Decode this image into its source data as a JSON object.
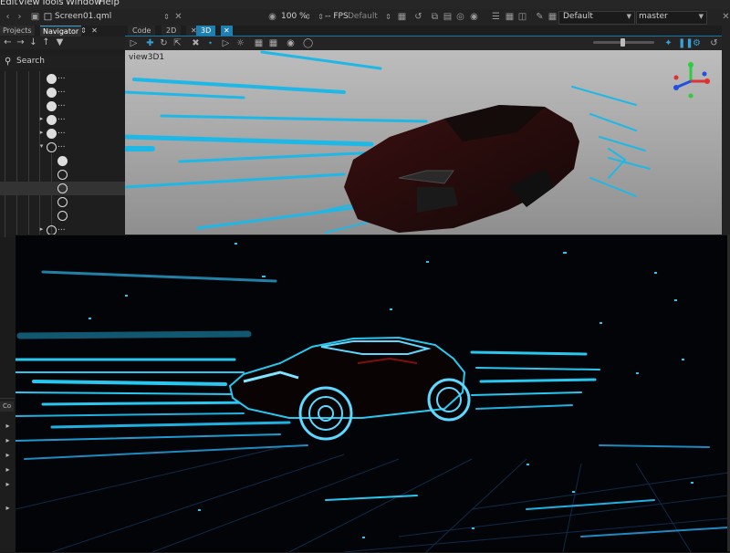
{
  "menu": [
    "Edit",
    "View",
    "Tools",
    "Window",
    "Help"
  ],
  "file": {
    "name": "Screen01.qml"
  },
  "toolbar": {
    "zoom": "100 %",
    "fps_label": "-- FPS",
    "fps_value": "Default",
    "style": "Default",
    "branch": "master"
  },
  "left_tabs": [
    "Projects",
    "Navigator"
  ],
  "search_label": "Search",
  "tree_rows": [
    {
      "label": "..."
    },
    {
      "label": "..."
    },
    {
      "label": "..."
    },
    {
      "label": "..."
    },
    {
      "label": "..."
    },
    {
      "label": "..."
    },
    {
      "label": ""
    },
    {
      "label": ""
    },
    {
      "label": ""
    },
    {
      "label": ""
    },
    {
      "label": ""
    },
    {
      "label": "..."
    }
  ],
  "editor_tabs": [
    "Code",
    "2D",
    "3D"
  ],
  "viewport": {
    "label": "view3D1"
  },
  "bottom_panel": {
    "tab": "Co"
  },
  "colors": {
    "accent": "#1f7fb0",
    "streak": "#29c7f0"
  }
}
